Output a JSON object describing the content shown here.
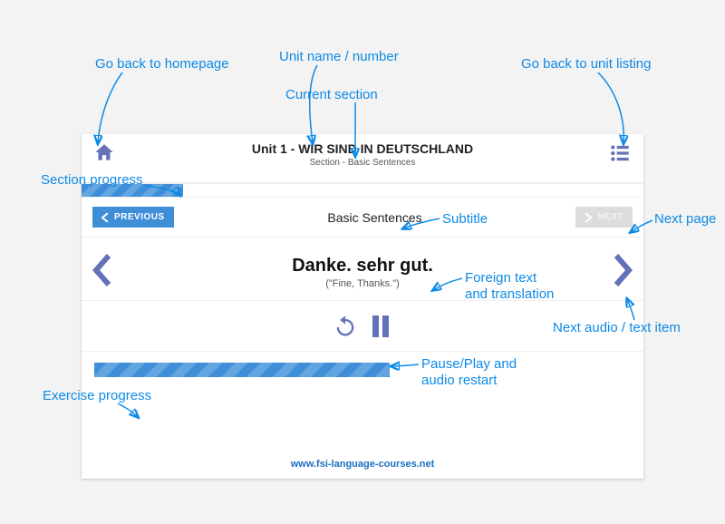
{
  "header": {
    "unit_title": "Unit 1 - WIR SIND IN DEUTSCHLAND",
    "section_line": "Section - Basic Sentences"
  },
  "nav": {
    "prev_label": "PREVIOUS",
    "subtitle": "Basic Sentences",
    "next_label": "NEXT"
  },
  "content": {
    "foreign": "Danke. sehr gut.",
    "translation": "(\"Fine, Thanks.\")"
  },
  "progress": {
    "section_percent": 18,
    "exercise_percent": 55
  },
  "footer": {
    "url": "www.fsi-language-courses.net"
  },
  "annotations": {
    "homepage": "Go back to homepage",
    "unit_name": "Unit name / number",
    "unit_listing": "Go back to unit listing",
    "current_section": "Current section",
    "section_progress": "Section progress",
    "subtitle": "Subtitle",
    "next_page": "Next page",
    "foreign_translation_l1": "Foreign text",
    "foreign_translation_l2": "and translation",
    "next_item": "Next audio / text item",
    "pause_play_l1": "Pause/Play and",
    "pause_play_l2": "audio restart",
    "exercise_progress": "Exercise progress"
  }
}
